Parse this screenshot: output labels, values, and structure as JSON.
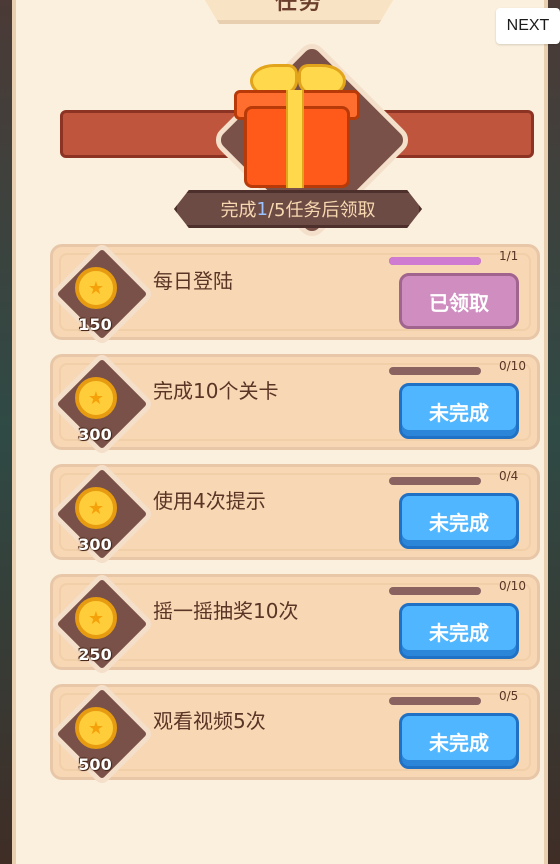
{
  "header": {
    "title": "任务",
    "next_label": "NEXT"
  },
  "reward_banner": {
    "icon": "gift-icon",
    "subtitle_prefix": "完成",
    "subtitle_count": "1",
    "subtitle_suffix": "/5任务后领取"
  },
  "tasks": [
    {
      "title": "每日登陆",
      "reward": "150",
      "progress_text": "1/1",
      "progress": 1.0,
      "button_label": "已领取",
      "status": "claimed"
    },
    {
      "title": "完成10个关卡",
      "reward": "300",
      "progress_text": "0/10",
      "progress": 0.0,
      "button_label": "未完成",
      "status": "incomplete"
    },
    {
      "title": "使用4次提示",
      "reward": "300",
      "progress_text": "0/4",
      "progress": 0.0,
      "button_label": "未完成",
      "status": "incomplete"
    },
    {
      "title": "摇一摇抽奖10次",
      "reward": "250",
      "progress_text": "0/10",
      "progress": 0.0,
      "button_label": "未完成",
      "status": "incomplete"
    },
    {
      "title": "观看视频5次",
      "reward": "500",
      "progress_text": "0/5",
      "progress": 0.0,
      "button_label": "未完成",
      "status": "incomplete"
    }
  ],
  "colors": {
    "panel": "#fbf0dd",
    "task_bg": "#f8d7b5",
    "button_blue": "#4fb6ff",
    "button_claimed": "#cf8dc0",
    "progress_fill": "#cf7bd1",
    "coin": "#ffcd3a",
    "gift": "#ff5a1a"
  }
}
